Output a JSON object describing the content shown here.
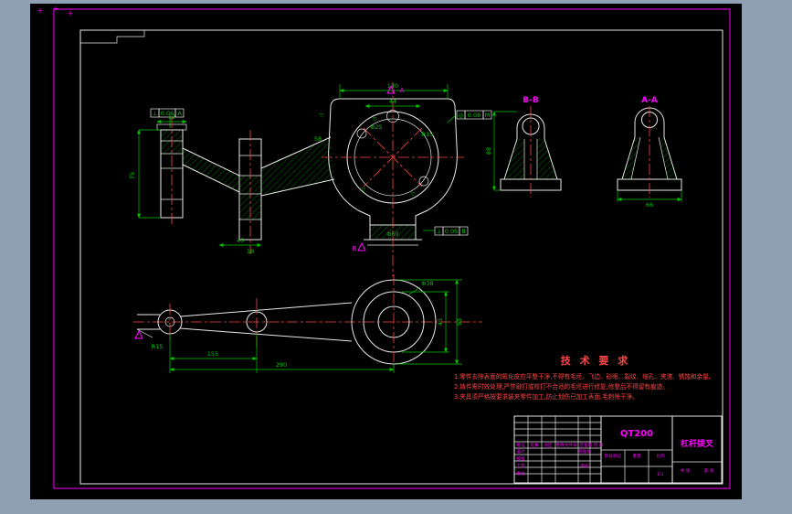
{
  "window": {
    "bg_outer": "#8fa0b2",
    "bg_canvas": "#000000"
  },
  "colors": {
    "frame_magenta": "#ff00ff",
    "sheet_border": "#e8e8e8",
    "line_green": "#00c800",
    "line_red": "#ff4545",
    "text_magenta": "#ff00ff",
    "text_red": "#ff4545"
  },
  "glyphs": {
    "plus": "+",
    "finish": "▽"
  },
  "sections": {
    "b": "B-B",
    "a": "A-A"
  },
  "datums": {
    "a": "A",
    "b": "B"
  },
  "gdt": [
    {
      "sym": "⊥",
      "val": "0.06",
      "ref": "A"
    },
    {
      "sym": "◎",
      "val": "0.08",
      "ref": "M"
    },
    {
      "sym": "⊥",
      "val": "0.05",
      "ref": "B"
    }
  ],
  "dims": [
    {
      "t": "130"
    },
    {
      "t": "44"
    },
    {
      "t": "Φ25"
    },
    {
      "t": "R15"
    },
    {
      "t": "Φ60"
    },
    {
      "t": "58"
    },
    {
      "t": "12"
    },
    {
      "t": "75"
    },
    {
      "t": "40"
    },
    {
      "t": "18"
    },
    {
      "t": "155"
    },
    {
      "t": "290"
    },
    {
      "t": "95"
    },
    {
      "t": "45"
    },
    {
      "t": "R15"
    },
    {
      "t": "88"
    },
    {
      "t": "Φ38"
    },
    {
      "t": "66"
    }
  ],
  "tech": {
    "title": "技 术 要 求",
    "lines": [
      "1.零件去除表面的氧化皮应平整干净,不得有毛坯、飞边、砂眼、裂纹、缩孔、夹渣、锈蚀和余量。",
      "2.铸件需时效处理,严禁敲打或校打不合适的毛坯进行修复,修整后不得留有痕迹。",
      "3.夹具须严格按要求装夹零件加工,防止划伤已加工表面,毛刺除干净。"
    ]
  },
  "titleblock": {
    "material": "QT200",
    "part_name": "杠杆拨叉",
    "mark": "标记",
    "count": "处数",
    "zone": "分区",
    "doc": "更改文件号",
    "sign": "签名",
    "date": "年.月.日",
    "design": "设计",
    "check": "校核",
    "craft": "工艺",
    "approve": "批准",
    "standard": "标准化",
    "audit": "审核",
    "stage": "阶段标记",
    "weight": "重量",
    "scale": "比例",
    "scale_val": "1:1",
    "sheets": "共 张",
    "sheet_no": "第 张"
  }
}
